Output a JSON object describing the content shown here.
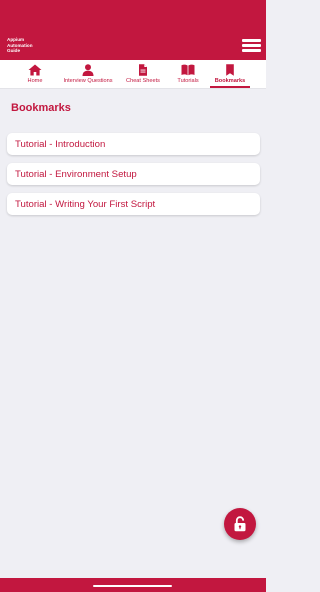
{
  "app": {
    "title_lines": [
      "Appium",
      "Automation",
      "Guide"
    ]
  },
  "tabs": [
    {
      "label": "Home",
      "icon": "home-icon",
      "active": false
    },
    {
      "label": "Interview Questions",
      "icon": "person-icon",
      "active": false
    },
    {
      "label": "Cheat Sheets",
      "icon": "document-icon",
      "active": false
    },
    {
      "label": "Tutorials",
      "icon": "open-book-icon",
      "active": false
    },
    {
      "label": "Bookmarks",
      "icon": "bookmark-icon",
      "active": true
    }
  ],
  "page": {
    "title": "Bookmarks"
  },
  "bookmarks": [
    {
      "label": "Tutorial - Introduction"
    },
    {
      "label": "Tutorial - Environment Setup"
    },
    {
      "label": "Tutorial - Writing Your First Script"
    }
  ],
  "fab": {
    "icon": "lock-icon"
  },
  "colors": {
    "brand": "#c2173f",
    "background": "#efeff4",
    "card": "#ffffff"
  }
}
